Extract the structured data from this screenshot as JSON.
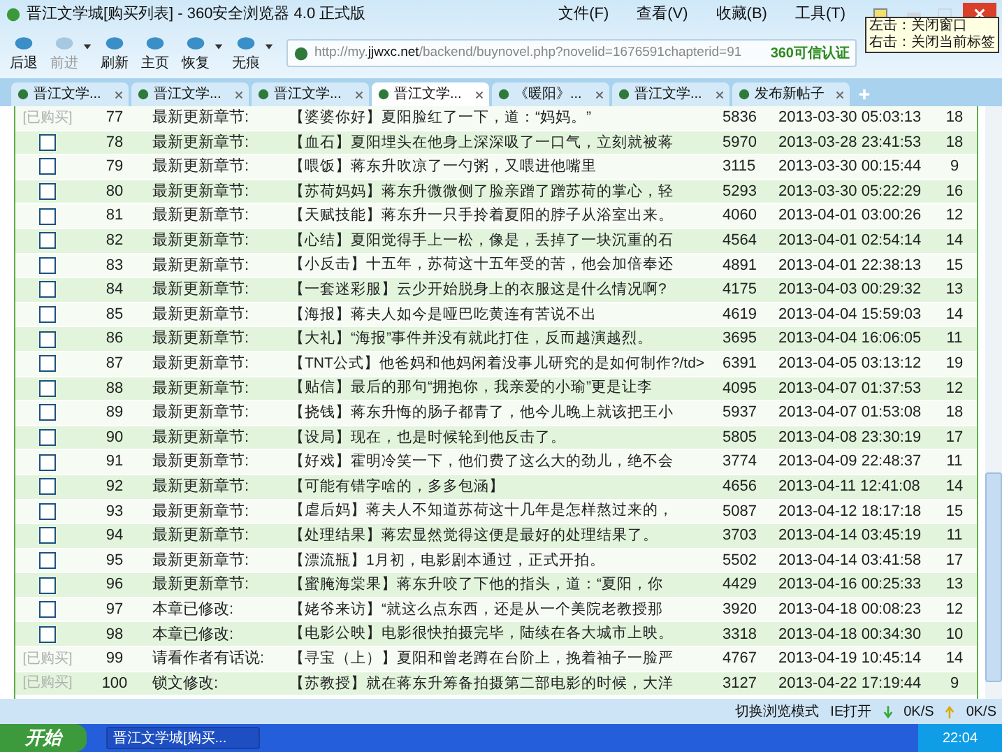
{
  "window": {
    "title": "晋江文学城[购买列表] - 360安全浏览器 4.0 正式版"
  },
  "menu": [
    "文件(F)",
    "查看(V)",
    "收藏(B)",
    "工具(T)"
  ],
  "tooltip": [
    "左击：关闭窗口",
    "右击：关闭当前标签"
  ],
  "toolbar": [
    {
      "label": "后退",
      "disabled": false,
      "dropdown": false
    },
    {
      "label": "前进",
      "disabled": true,
      "dropdown": true
    },
    {
      "label": "刷新",
      "disabled": false,
      "dropdown": false
    },
    {
      "label": "主页",
      "disabled": false,
      "dropdown": false
    },
    {
      "label": "恢复",
      "disabled": false,
      "dropdown": true
    },
    {
      "label": "无痕",
      "disabled": false,
      "dropdown": true
    }
  ],
  "address": {
    "prefix": "http://my.",
    "domain": "jjwxc.net",
    "path": "/backend/buynovel.php?novelid=1676591chapterid=91",
    "badge": "360可信认证"
  },
  "tabs": [
    {
      "label": "晋江文学...",
      "selected": false
    },
    {
      "label": "晋江文学...",
      "selected": false
    },
    {
      "label": "晋江文学...",
      "selected": false
    },
    {
      "label": "晋江文学...",
      "selected": true
    },
    {
      "label": "《暖阳》...",
      "selected": false
    },
    {
      "label": "晋江文学...",
      "selected": false
    },
    {
      "label": "发布新帖子",
      "selected": false
    }
  ],
  "table": {
    "rows": [
      {
        "kind": "purchased",
        "status": "[已购买]",
        "number": "77",
        "type": "最新更新章节:",
        "title": "【婆婆你好】夏阳脸红了一下，道：“妈妈。”",
        "words": "5836",
        "time": "2013-03-30 05:03:13",
        "count": "18"
      },
      {
        "kind": "checkbox",
        "checked": false,
        "number": "78",
        "type": "最新更新章节:",
        "title": "【血石】夏阳埋头在他身上深深吸了一口气，立刻就被蒋",
        "words": "5970",
        "time": "2013-03-28 23:41:53",
        "count": "18"
      },
      {
        "kind": "checkbox",
        "checked": false,
        "number": "79",
        "type": "最新更新章节:",
        "title": "【喂饭】蒋东升吹凉了一勺粥，又喂进他嘴里",
        "words": "3115",
        "time": "2013-03-30 00:15:44",
        "count": "9"
      },
      {
        "kind": "checkbox",
        "checked": false,
        "number": "80",
        "type": "最新更新章节:",
        "title": "【苏荷妈妈】蒋东升微微侧了脸亲蹭了蹭苏荷的掌心，轻",
        "words": "5293",
        "time": "2013-03-30 05:22:29",
        "count": "16"
      },
      {
        "kind": "checkbox",
        "checked": false,
        "number": "81",
        "type": "最新更新章节:",
        "title": "【天赋技能】蒋东升一只手拎着夏阳的脖子从浴室出来。",
        "words": "4060",
        "time": "2013-04-01 03:00:26",
        "count": "12"
      },
      {
        "kind": "checkbox",
        "checked": false,
        "number": "82",
        "type": "最新更新章节:",
        "title": "【心结】夏阳觉得手上一松，像是，丢掉了一块沉重的石",
        "words": "4564",
        "time": "2013-04-01 02:54:14",
        "count": "14"
      },
      {
        "kind": "checkbox",
        "checked": false,
        "number": "83",
        "type": "最新更新章节:",
        "title": "【小反击】十五年，苏荷这十五年受的苦，他会加倍奉还",
        "words": "4891",
        "time": "2013-04-01 22:38:13",
        "count": "15"
      },
      {
        "kind": "checkbox",
        "checked": false,
        "number": "84",
        "type": "最新更新章节:",
        "title": "【一套迷彩服】云少开始脱身上的衣服这是什么情况啊?",
        "words": "4175",
        "time": "2013-04-03 00:29:32",
        "count": "13"
      },
      {
        "kind": "checkbox",
        "checked": false,
        "number": "85",
        "type": "最新更新章节:",
        "title": "【海报】蒋夫人如今是哑巴吃黄连有苦说不出",
        "words": "4619",
        "time": "2013-04-04 15:59:03",
        "count": "14"
      },
      {
        "kind": "checkbox",
        "checked": false,
        "number": "86",
        "type": "最新更新章节:",
        "title": "【大礼】“海报”事件并没有就此打住，反而越演越烈。",
        "words": "3695",
        "time": "2013-04-04 16:06:05",
        "count": "11"
      },
      {
        "kind": "checkbox",
        "checked": false,
        "number": "87",
        "type": "最新更新章节:",
        "title": "【TNT公式】他爸妈和他妈闲着没事儿研究的是如何制作?/td>",
        "words": "6391",
        "time": "2013-04-05 03:13:12",
        "count": "19"
      },
      {
        "kind": "checkbox",
        "checked": false,
        "number": "88",
        "type": "最新更新章节:",
        "title": "【贴信】最后的那句“拥抱你，我亲爱的小瑜”更是让李",
        "words": "4095",
        "time": "2013-04-07 01:37:53",
        "count": "12"
      },
      {
        "kind": "checkbox",
        "checked": false,
        "number": "89",
        "type": "最新更新章节:",
        "title": "【挠钱】蒋东升悔的肠子都青了，他今儿晚上就该把王小",
        "words": "5937",
        "time": "2013-04-07 01:53:08",
        "count": "18"
      },
      {
        "kind": "checkbox",
        "checked": false,
        "number": "90",
        "type": "最新更新章节:",
        "title": "【设局】现在，也是时候轮到他反击了。",
        "words": "5805",
        "time": "2013-04-08 23:30:19",
        "count": "17"
      },
      {
        "kind": "checkbox",
        "checked": false,
        "number": "91",
        "type": "最新更新章节:",
        "title": "【好戏】霍明冷笑一下，他们费了这么大的劲儿，绝不会",
        "words": "3774",
        "time": "2013-04-09 22:48:37",
        "count": "11"
      },
      {
        "kind": "checkbox",
        "checked": false,
        "number": "92",
        "type": "最新更新章节:",
        "title": "【可能有错字啥的，多多包涵】",
        "words": "4656",
        "time": "2013-04-11 12:41:08",
        "count": "14"
      },
      {
        "kind": "checkbox",
        "checked": false,
        "number": "93",
        "type": "最新更新章节:",
        "title": "【虐后妈】蒋夫人不知道苏荷这十几年是怎样熬过来的，",
        "words": "5087",
        "time": "2013-04-12 18:17:18",
        "count": "15"
      },
      {
        "kind": "checkbox",
        "checked": false,
        "number": "94",
        "type": "最新更新章节:",
        "title": "【处理结果】蒋宏显然觉得这便是最好的处理结果了。",
        "words": "3703",
        "time": "2013-04-14 03:45:19",
        "count": "11"
      },
      {
        "kind": "checkbox",
        "checked": false,
        "number": "95",
        "type": "最新更新章节:",
        "title": "【漂流瓶】1月初，电影剧本通过，正式开拍。",
        "words": "5502",
        "time": "2013-04-14 03:41:58",
        "count": "17"
      },
      {
        "kind": "checkbox",
        "checked": false,
        "number": "96",
        "type": "最新更新章节:",
        "title": "【蜜腌海棠果】蒋东升咬了下他的指头，道：“夏阳，你",
        "words": "4429",
        "time": "2013-04-16 00:25:33",
        "count": "13"
      },
      {
        "kind": "checkbox",
        "checked": false,
        "number": "97",
        "type": "本章已修改:",
        "title": "【姥爷来访】“就这么点东西，还是从一个美院老教授那",
        "words": "3920",
        "time": "2013-04-18 00:08:23",
        "count": "12"
      },
      {
        "kind": "checkbox",
        "checked": false,
        "number": "98",
        "type": "本章已修改:",
        "title": "【电影公映】电影很快拍摄完毕，陆续在各大城市上映。",
        "words": "3318",
        "time": "2013-04-18 00:34:30",
        "count": "10"
      },
      {
        "kind": "purchased",
        "status": "[已购买]",
        "number": "99",
        "type": "请看作者有话说:",
        "title": "【寻宝（上）】夏阳和曾老蹲在台阶上，挽着袖子一脸严",
        "words": "4767",
        "time": "2013-04-19 10:45:14",
        "count": "14"
      },
      {
        "kind": "purchased",
        "status": "[已购买]",
        "number": "100",
        "type": "锁文修改:",
        "title": "【苏教授】就在蒋东升筹备拍摄第二部电影的时候，大洋",
        "words": "3127",
        "time": "2013-04-22 17:19:44",
        "count": "9"
      }
    ]
  },
  "status_bar": {
    "mode": "切换浏览模式",
    "ie": "IE打开",
    "down": "0K/S",
    "up": "0K/S"
  },
  "taskbar": {
    "start": "开始",
    "task": "晋江文学城[购买...",
    "clock": "22:04"
  }
}
